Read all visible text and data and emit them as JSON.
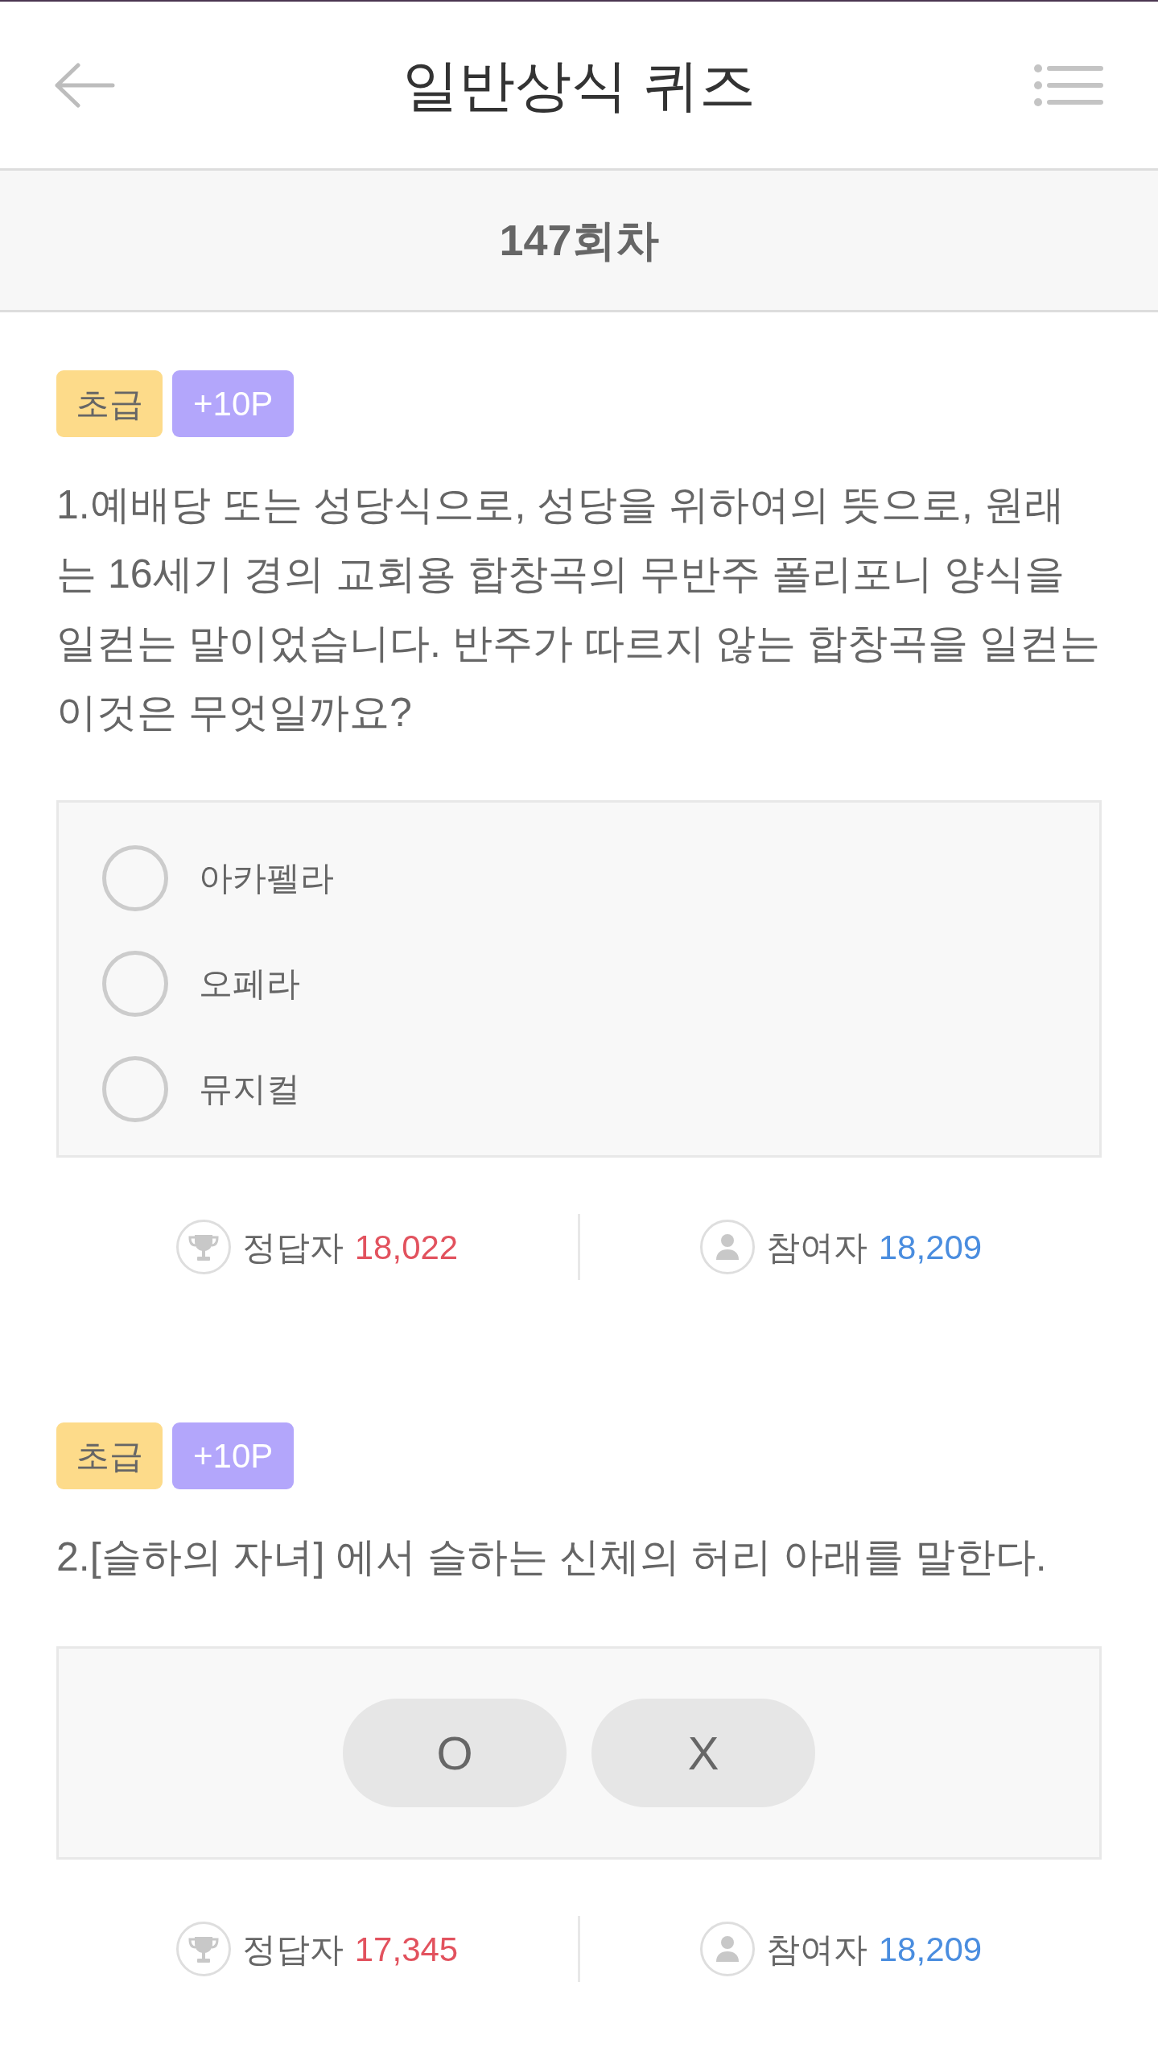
{
  "header": {
    "title": "일반상식 퀴즈"
  },
  "round": {
    "label": "147회차"
  },
  "questions": [
    {
      "kind": "choice",
      "difficulty": "초급",
      "points": "+10P",
      "text": "1.예배당 또는 성당식으로, 성당을 위하여의 뜻으로, 원래는 16세기 경의 교회용 합창곡의 무반주 폴리포니 양식을 일컫는 말이었습니다. 반주가 따르지 않는 합창곡을 일컫는 이것은 무엇일까요?",
      "options": [
        {
          "label": "아카펠라",
          "selected": false
        },
        {
          "label": "오페라",
          "selected": false
        },
        {
          "label": "뮤지컬",
          "selected": false
        }
      ],
      "stats": {
        "correct_label": "정답자",
        "correct_count": "18,022",
        "participants_label": "참여자",
        "participants_count": "18,209"
      }
    },
    {
      "kind": "ox",
      "difficulty": "초급",
      "points": "+10P",
      "text": "2.[슬하의 자녀] 에서 슬하는 신체의 허리 아래를 말한다.",
      "options": [
        {
          "label": "O",
          "selected": false
        },
        {
          "label": "X",
          "selected": false
        }
      ],
      "stats": {
        "correct_label": "정답자",
        "correct_count": "17,345",
        "participants_label": "참여자",
        "participants_count": "18,209"
      }
    }
  ]
}
